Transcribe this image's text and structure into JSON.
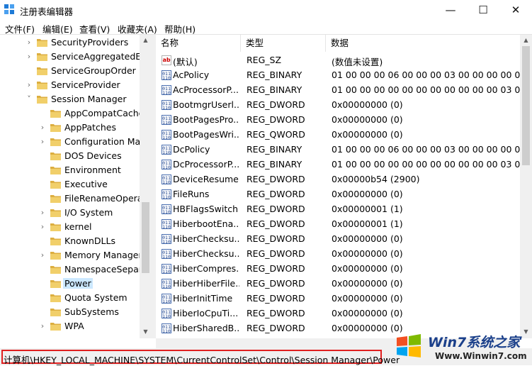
{
  "window": {
    "title": "注册表编辑器",
    "minimize": "—",
    "maximize": "☐",
    "close": "✕"
  },
  "menu": [
    "文件(F)",
    "编辑(E)",
    "查看(V)",
    "收藏夹(A)",
    "帮助(H)"
  ],
  "tree": [
    {
      "label": "SecurityProviders",
      "expander": ">",
      "level": 1
    },
    {
      "label": "ServiceAggregatedEv",
      "expander": ">",
      "level": 1
    },
    {
      "label": "ServiceGroupOrder",
      "expander": "",
      "level": 1
    },
    {
      "label": "ServiceProvider",
      "expander": ">",
      "level": 1
    },
    {
      "label": "Session Manager",
      "expander": "v",
      "level": 1
    },
    {
      "label": "AppCompatCache",
      "expander": "",
      "level": 2
    },
    {
      "label": "AppPatches",
      "expander": ">",
      "level": 2
    },
    {
      "label": "Configuration Mar",
      "expander": ">",
      "level": 2
    },
    {
      "label": "DOS Devices",
      "expander": "",
      "level": 2
    },
    {
      "label": "Environment",
      "expander": "",
      "level": 2
    },
    {
      "label": "Executive",
      "expander": "",
      "level": 2
    },
    {
      "label": "FileRenameOperat",
      "expander": "",
      "level": 2
    },
    {
      "label": "I/O System",
      "expander": ">",
      "level": 2
    },
    {
      "label": "kernel",
      "expander": ">",
      "level": 2
    },
    {
      "label": "KnownDLLs",
      "expander": "",
      "level": 2
    },
    {
      "label": "Memory Manager",
      "expander": ">",
      "level": 2
    },
    {
      "label": "NamespaceSepara",
      "expander": "",
      "level": 2
    },
    {
      "label": "Power",
      "expander": "",
      "level": 2,
      "selected": true
    },
    {
      "label": "Quota System",
      "expander": "",
      "level": 2
    },
    {
      "label": "SubSystems",
      "expander": "",
      "level": 2
    },
    {
      "label": "WPA",
      "expander": ">",
      "level": 2
    }
  ],
  "columns": {
    "name": "名称",
    "type": "类型",
    "data": "数据"
  },
  "values": [
    {
      "icon": "string-value-icon",
      "name": "(默认)",
      "type": "REG_SZ",
      "data": "(数值未设置)"
    },
    {
      "icon": "binary-value-icon",
      "name": "AcPolicy",
      "type": "REG_BINARY",
      "data": "01 00 00 00 06 00 00 00 03 00 00 00 00 00 0"
    },
    {
      "icon": "binary-value-icon",
      "name": "AcProcessorP...",
      "type": "REG_BINARY",
      "data": "01 00 00 00 00 00 00 00 00 00 00 00 03 00 0"
    },
    {
      "icon": "binary-value-icon",
      "name": "BootmgrUserl...",
      "type": "REG_DWORD",
      "data": "0x00000000 (0)"
    },
    {
      "icon": "binary-value-icon",
      "name": "BootPagesPro...",
      "type": "REG_DWORD",
      "data": "0x00000000 (0)"
    },
    {
      "icon": "binary-value-icon",
      "name": "BootPagesWri...",
      "type": "REG_QWORD",
      "data": "0x00000000 (0)"
    },
    {
      "icon": "binary-value-icon",
      "name": "DcPolicy",
      "type": "REG_BINARY",
      "data": "01 00 00 00 06 00 00 00 03 00 00 00 00 00 0"
    },
    {
      "icon": "binary-value-icon",
      "name": "DcProcessorP...",
      "type": "REG_BINARY",
      "data": "01 00 00 00 00 00 00 00 00 00 00 00 03 00 0"
    },
    {
      "icon": "binary-value-icon",
      "name": "DeviceResume...",
      "type": "REG_DWORD",
      "data": "0x00000b54 (2900)"
    },
    {
      "icon": "binary-value-icon",
      "name": "FileRuns",
      "type": "REG_DWORD",
      "data": "0x00000000 (0)"
    },
    {
      "icon": "binary-value-icon",
      "name": "HBFlagsSwitch",
      "type": "REG_DWORD",
      "data": "0x00000001 (1)"
    },
    {
      "icon": "binary-value-icon",
      "name": "HiberbootEna...",
      "type": "REG_DWORD",
      "data": "0x00000001 (1)"
    },
    {
      "icon": "binary-value-icon",
      "name": "HiberChecksu...",
      "type": "REG_DWORD",
      "data": "0x00000000 (0)"
    },
    {
      "icon": "binary-value-icon",
      "name": "HiberChecksu...",
      "type": "REG_DWORD",
      "data": "0x00000000 (0)"
    },
    {
      "icon": "binary-value-icon",
      "name": "HiberCompres...",
      "type": "REG_DWORD",
      "data": "0x00000000 (0)"
    },
    {
      "icon": "binary-value-icon",
      "name": "HiberHiberFile...",
      "type": "REG_DWORD",
      "data": "0x00000000 (0)"
    },
    {
      "icon": "binary-value-icon",
      "name": "HiberInitTime",
      "type": "REG_DWORD",
      "data": "0x00000000 (0)"
    },
    {
      "icon": "binary-value-icon",
      "name": "HiberIoCpuTi...",
      "type": "REG_DWORD",
      "data": "0x00000000 (0)"
    },
    {
      "icon": "binary-value-icon",
      "name": "HiberSharedB...",
      "type": "REG_DWORD",
      "data": "0x00000000 (0)"
    }
  ],
  "status": {
    "path": "计算机\\HKEY_LOCAL_MACHINE\\SYSTEM\\CurrentControlSet\\Control\\Session Manager\\Power"
  },
  "watermark": {
    "brand": "Win7系统之家",
    "url": "Www.Winwin7.com"
  },
  "colors": {
    "selection": "#cce8ff",
    "highlight_border": "#e02020",
    "folder": "#e8c25c"
  }
}
